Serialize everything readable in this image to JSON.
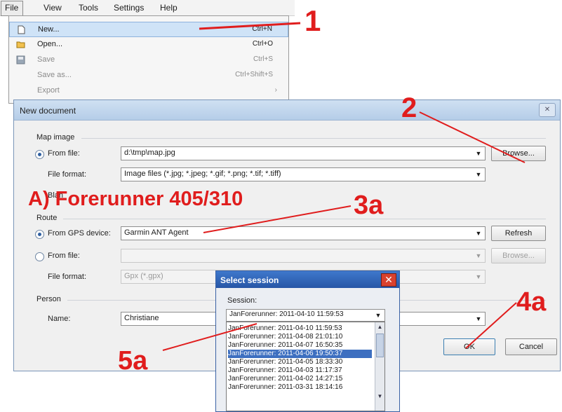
{
  "menubar": {
    "items": [
      "File",
      "View",
      "Tools",
      "Settings",
      "Help"
    ]
  },
  "file_menu": {
    "items": [
      {
        "label": "New...",
        "shortcut": "Ctrl+N",
        "icon": "new-document-icon"
      },
      {
        "label": "Open...",
        "shortcut": "Ctrl+O",
        "icon": "open-folder-icon"
      },
      {
        "label": "Save",
        "shortcut": "Ctrl+S",
        "icon": "save-disk-icon"
      },
      {
        "label": "Save as...",
        "shortcut": "Ctrl+Shift+S"
      },
      {
        "label": "Export",
        "arrow": "›"
      }
    ]
  },
  "dialog": {
    "title": "New document",
    "close_glyph": "✕",
    "map_image": {
      "group": "Map image",
      "from_file_label": "From file:",
      "from_file_value": "d:\\tmp\\map.jpg",
      "browse_label": "Browse...",
      "file_format_label": "File format:",
      "file_format_value": "Image files  (*.jpg; *.jpeg; *.gif; *.png; *.tif; *.tiff)",
      "blank_fragment": "Blan"
    },
    "route": {
      "group": "Route",
      "from_gps_label": "From GPS device:",
      "from_gps_value": "Garmin ANT Agent",
      "refresh_label": "Refresh",
      "from_file_label": "From file:",
      "browse_label": "Browse...",
      "file_format_label": "File format:",
      "file_format_value": "Gpx (*.gpx)"
    },
    "person": {
      "group": "Person",
      "name_label": "Name:",
      "name_value": "Christiane"
    },
    "ok_label": "OK",
    "cancel_label": "Cancel"
  },
  "session_dialog": {
    "title": "Select session",
    "close_glyph": "✕",
    "session_label": "Session:",
    "selected_value": "JanForerunner: 2011-04-10 11:59:53",
    "items": [
      "JanForerunner: 2011-04-10 11:59:53",
      "JanForerunner: 2011-04-08 21:01:10",
      "JanForerunner: 2011-04-07 16:50:35",
      "JanForerunner: 2011-04-06 19:50:37",
      "JanForerunner: 2011-04-05 18:33:30",
      "JanForerunner: 2011-04-03 11:17:37",
      "JanForerunner: 2011-04-02 14:27:15",
      "JanForerunner: 2011-03-31 18:14:16"
    ],
    "highlighted_index": 3
  },
  "annotations": {
    "step1": "1",
    "step2": "2",
    "step3a": "3a",
    "step4a": "4a",
    "step5a": "5a",
    "heading": "A) Forerunner 405/310",
    "color": "#e01d1d"
  }
}
